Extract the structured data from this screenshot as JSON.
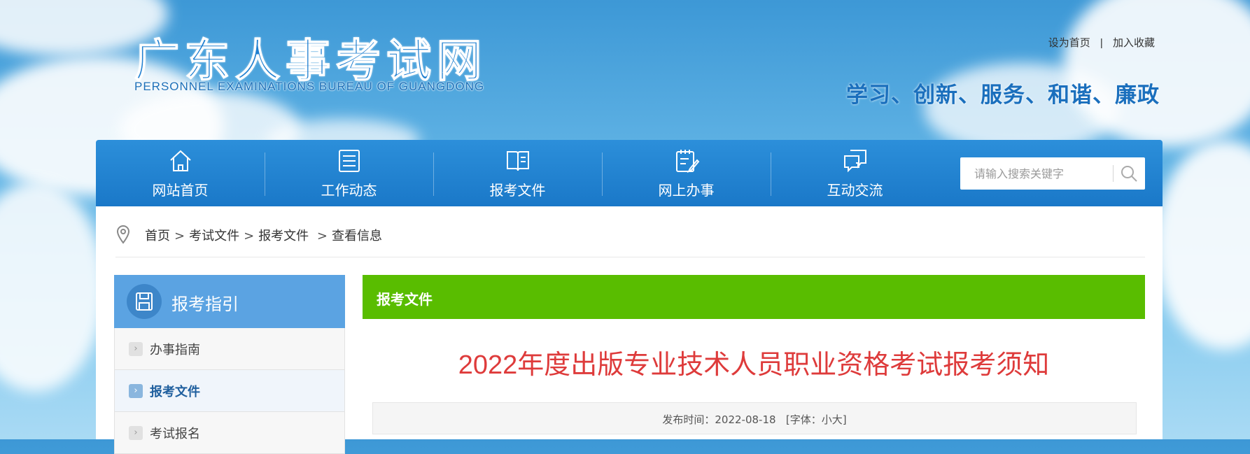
{
  "header": {
    "logo_cn": "广东人事考试网",
    "logo_en": "PERSONNEL EXAMINATIONS BUREAU OF GUANGDONG",
    "toplinks": {
      "set_home": "设为首页",
      "separator": "|",
      "favorite": "加入收藏"
    },
    "slogan": "学习、创新、服务、和谐、廉政"
  },
  "nav": {
    "items": [
      {
        "label": "网站首页",
        "icon": "home-icon"
      },
      {
        "label": "工作动态",
        "icon": "document-list-icon"
      },
      {
        "label": "报考文件",
        "icon": "open-book-icon"
      },
      {
        "label": "网上办事",
        "icon": "clipboard-edit-icon"
      },
      {
        "label": "互动交流",
        "icon": "chat-bubbles-icon"
      }
    ],
    "search": {
      "placeholder": "请输入搜索关键字",
      "icon": "search-icon"
    }
  },
  "breadcrumb": {
    "icon": "location-pin-icon",
    "items": [
      "首页",
      "考试文件",
      "报考文件",
      "查看信息"
    ],
    "separator": ">"
  },
  "sidebar": {
    "title": "报考指引",
    "icon": "floppy-disk-icon",
    "items": [
      {
        "label": "办事指南",
        "active": false
      },
      {
        "label": "报考文件",
        "active": true
      },
      {
        "label": "考试报名",
        "active": false
      }
    ]
  },
  "main": {
    "section_title": "报考文件",
    "article_title": "2022年度出版专业技术人员职业资格考试报考须知",
    "meta": {
      "publish_label": "发布时间：",
      "publish_date": "2022-08-18",
      "font_open": "[字体：",
      "font_small": "小",
      "font_large": "大",
      "font_close": "]"
    }
  },
  "colors": {
    "nav_blue": "#1f82cf",
    "sidebar_head": "#5ba3e2",
    "green_bar": "#59bd00",
    "title_red": "#de3b3b",
    "slogan_blue": "#1a6fbd"
  }
}
